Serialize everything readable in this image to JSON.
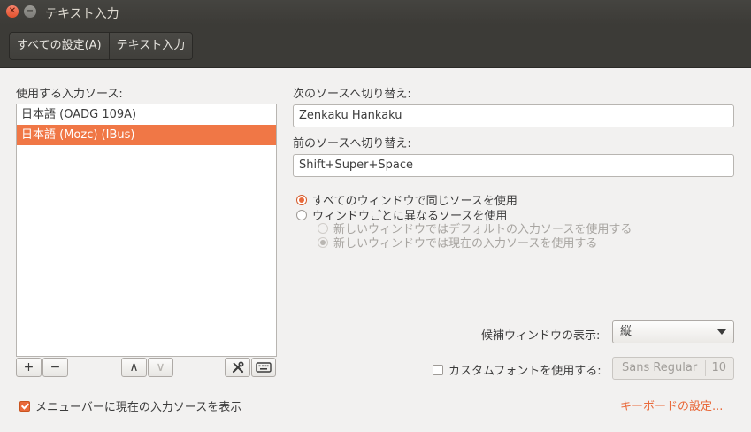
{
  "window": {
    "title": "テキスト入力"
  },
  "breadcrumb": [
    "すべての設定(A)",
    "テキスト入力"
  ],
  "sources": {
    "label": "使用する入力ソース:",
    "items": [
      {
        "label": "日本語 (OADG 109A)",
        "selected": false
      },
      {
        "label": "日本語 (Mozc) (IBus)",
        "selected": true
      }
    ],
    "toolbar": {
      "add": "+",
      "remove": "−",
      "up": "∧",
      "down": "∨"
    }
  },
  "switching": {
    "next_label": "次のソースへ切り替え:",
    "next_value": "Zenkaku Hankaku",
    "prev_label": "前のソースへ切り替え:",
    "prev_value": "Shift+Super+Space"
  },
  "options": {
    "same_source": "すべてのウィンドウで同じソースを使用",
    "per_window": "ウィンドウごとに異なるソースを使用",
    "default_source": "新しいウィンドウではデフォルトの入力ソースを使用する",
    "current_source": "新しいウィンドウでは現在の入力ソースを使用する"
  },
  "candidate": {
    "label": "候補ウィンドウの表示:",
    "value": "縦"
  },
  "custom_font": {
    "label": "カスタムフォントを使用する:",
    "checked": false,
    "font_name": "Sans Regular",
    "font_size": "10"
  },
  "menubar_indicator": {
    "label": "メニューバーに現在の入力ソースを表示",
    "checked": true
  },
  "keyboard_settings_link": "キーボードの設定...",
  "colors": {
    "accent": "#f07746",
    "titlebar": "#3c3b37",
    "background": "#f2f1f0"
  }
}
